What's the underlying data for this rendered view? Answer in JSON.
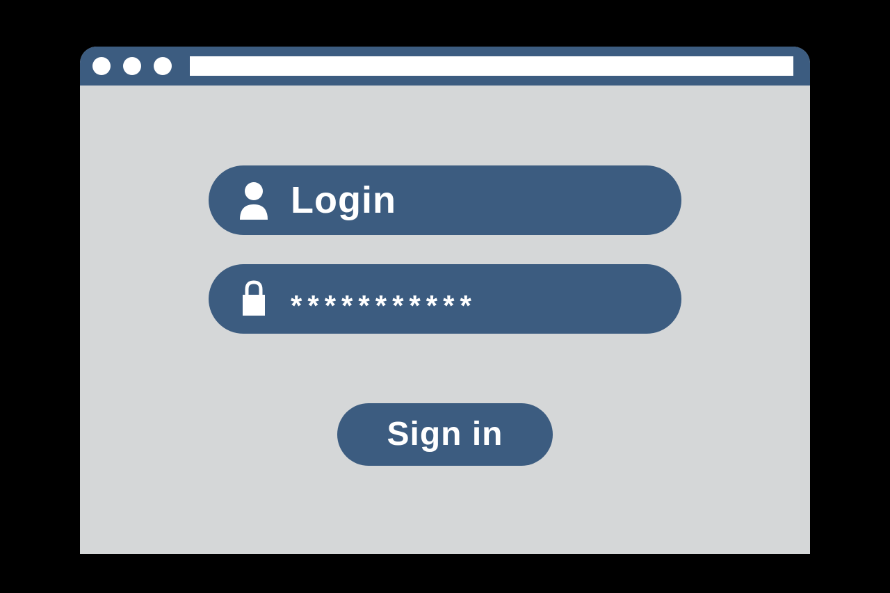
{
  "colors": {
    "chrome": "#3c5c80",
    "page_bg": "#d5d7d8",
    "outer_bg": "#000000",
    "text_on_chrome": "#ffffff"
  },
  "title_bar": {
    "address_value": ""
  },
  "login_form": {
    "username_label": "Login",
    "password_mask": "***********",
    "submit_label": "Sign in"
  },
  "icons": {
    "user": "user-icon",
    "lock": "lock-icon"
  }
}
